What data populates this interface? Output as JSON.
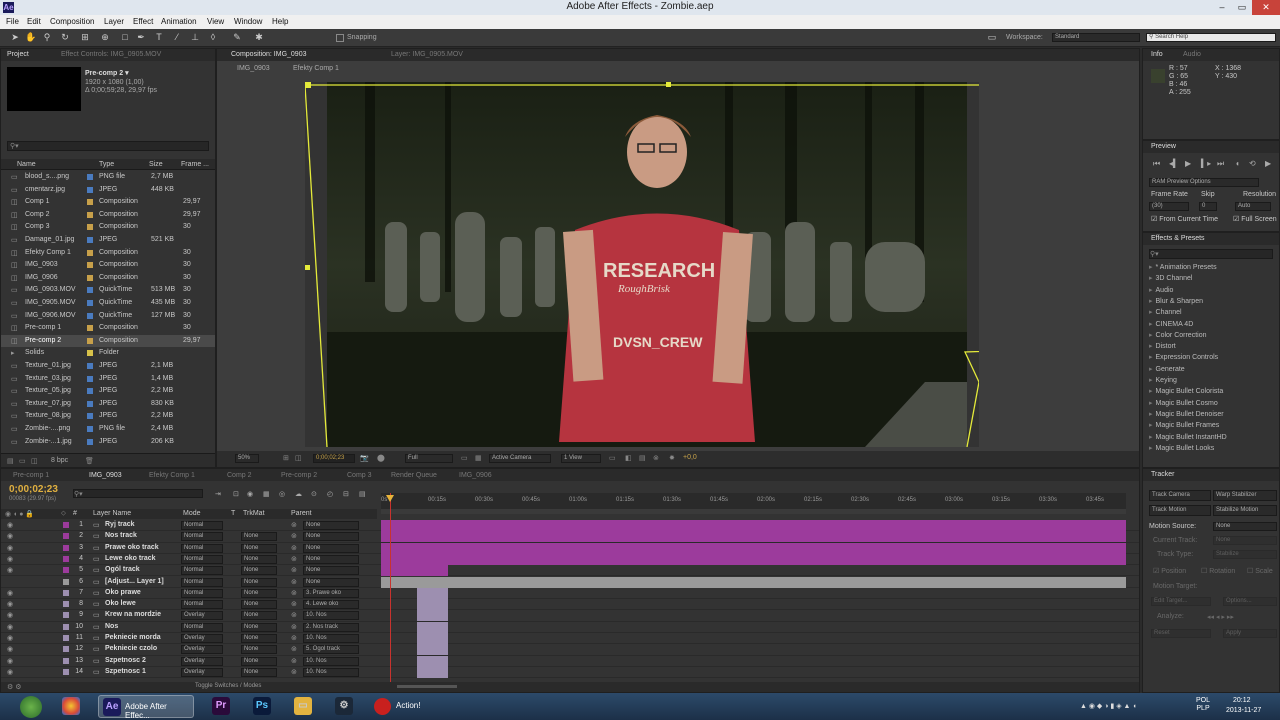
{
  "window": {
    "title": "Adobe After Effects - Zombie.aep",
    "app_icon": "Ae"
  },
  "menu": [
    "File",
    "Edit",
    "Composition",
    "Layer",
    "Effect",
    "Animation",
    "View",
    "Window",
    "Help"
  ],
  "toolbar": {
    "snapping": "Snapping",
    "workspace_label": "Workspace:",
    "workspace_value": "Standard",
    "search_placeholder": "Search Help"
  },
  "project": {
    "tabs": [
      "Project",
      "Effect Controls: IMG_0905.MOV"
    ],
    "selected": {
      "name": "Pre-comp 2 ▾",
      "size": "1920 x 1080 (1,00)",
      "duration": "Δ 0;00;59;28, 29,97 fps"
    },
    "columns": [
      "Name",
      "Type",
      "Size",
      "Frame ..."
    ],
    "items": [
      {
        "name": "blood_s....png",
        "type": "PNG file",
        "size": "2,7 MB",
        "frame": "",
        "color": "#4a7bbf"
      },
      {
        "name": "cmentarz.jpg",
        "type": "JPEG",
        "size": "448 KB",
        "frame": "",
        "color": "#4a7bbf"
      },
      {
        "name": "Comp 1",
        "type": "Composition",
        "size": "",
        "frame": "29,97",
        "color": "#c7a04a"
      },
      {
        "name": "Comp 2",
        "type": "Composition",
        "size": "",
        "frame": "29,97",
        "color": "#c7a04a"
      },
      {
        "name": "Comp 3",
        "type": "Composition",
        "size": "",
        "frame": "30",
        "color": "#c7a04a"
      },
      {
        "name": "Damage_01.jpg",
        "type": "JPEG",
        "size": "521 KB",
        "frame": "",
        "color": "#4a7bbf"
      },
      {
        "name": "Efekty Comp 1",
        "type": "Composition",
        "size": "",
        "frame": "30",
        "color": "#c7a04a"
      },
      {
        "name": "IMG_0903",
        "type": "Composition",
        "size": "",
        "frame": "30",
        "color": "#c7a04a"
      },
      {
        "name": "IMG_0906",
        "type": "Composition",
        "size": "",
        "frame": "30",
        "color": "#c7a04a"
      },
      {
        "name": "IMG_0903.MOV",
        "type": "QuickTime",
        "size": "513 MB",
        "frame": "30",
        "color": "#4a7bbf"
      },
      {
        "name": "IMG_0905.MOV",
        "type": "QuickTime",
        "size": "435 MB",
        "frame": "30",
        "color": "#4a7bbf"
      },
      {
        "name": "IMG_0906.MOV",
        "type": "QuickTime",
        "size": "127 MB",
        "frame": "30",
        "color": "#4a7bbf"
      },
      {
        "name": "Pre-comp 1",
        "type": "Composition",
        "size": "",
        "frame": "30",
        "color": "#c7a04a"
      },
      {
        "name": "Pre-comp 2",
        "type": "Composition",
        "size": "",
        "frame": "29,97",
        "color": "#c7a04a"
      },
      {
        "name": "Solids",
        "type": "Folder",
        "size": "",
        "frame": "",
        "color": "#d8c24a"
      },
      {
        "name": "Texture_01.jpg",
        "type": "JPEG",
        "size": "2,1 MB",
        "frame": "",
        "color": "#4a7bbf"
      },
      {
        "name": "Texture_03.jpg",
        "type": "JPEG",
        "size": "1,4 MB",
        "frame": "",
        "color": "#4a7bbf"
      },
      {
        "name": "Texture_05.jpg",
        "type": "JPEG",
        "size": "2,2 MB",
        "frame": "",
        "color": "#4a7bbf"
      },
      {
        "name": "Texture_07.jpg",
        "type": "JPEG",
        "size": "830 KB",
        "frame": "",
        "color": "#4a7bbf"
      },
      {
        "name": "Texture_08.jpg",
        "type": "JPEG",
        "size": "2,2 MB",
        "frame": "",
        "color": "#4a7bbf"
      },
      {
        "name": "Zombie-....png",
        "type": "PNG file",
        "size": "2,4 MB",
        "frame": "",
        "color": "#4a7bbf"
      },
      {
        "name": "Zombie-...1.jpg",
        "type": "JPEG",
        "size": "206 KB",
        "frame": "",
        "color": "#4a7bbf"
      }
    ],
    "bpc": "8 bpc"
  },
  "composition": {
    "tabs": [
      "Composition: IMG_0903",
      "Layer: IMG_0905.MOV"
    ],
    "breadcrumbs": [
      "IMG_0903",
      "Efekty Comp 1"
    ],
    "zoom": "50%",
    "timecode": "0;00;02;23",
    "resolution": "Full",
    "camera": "Active Camera",
    "view": "1 View",
    "exposure": "+0,0",
    "shirt_text": [
      "RESEARCH",
      "RoughBrisk",
      "DVSN_CREW"
    ]
  },
  "info": {
    "tabs": [
      "Info",
      "Audio"
    ],
    "r": "R : 57",
    "g": "G : 65",
    "b": "B : 46",
    "a": "A : 255",
    "x": "X : 1368",
    "y": "Y : 430"
  },
  "preview": {
    "tab": "Preview",
    "ram_options": "RAM Preview Options",
    "frame_rate_label": "Frame Rate",
    "skip_label": "Skip",
    "resolution_label": "Resolution",
    "frame_rate": "(30)",
    "skip": "0",
    "resolution": "Auto",
    "from_current": "From Current Time",
    "full_screen": "Full Screen"
  },
  "effects": {
    "tab": "Effects & Presets",
    "items": [
      "* Animation Presets",
      "3D Channel",
      "Audio",
      "Blur & Sharpen",
      "Channel",
      "CINEMA 4D",
      "Color Correction",
      "Distort",
      "Expression Controls",
      "Generate",
      "Keying",
      "Magic Bullet Colorista",
      "Magic Bullet Cosmo",
      "Magic Bullet Denoiser",
      "Magic Bullet Frames",
      "Magic Bullet InstantHD",
      "Magic Bullet Looks"
    ]
  },
  "tracker": {
    "tab": "Tracker",
    "track_camera": "Track Camera",
    "warp_stabilizer": "Warp Stabilizer",
    "track_motion": "Track Motion",
    "stabilize_motion": "Stabilize Motion",
    "motion_source_label": "Motion Source:",
    "motion_source": "None",
    "current_track": "Current Track:",
    "current_track_value": "None",
    "track_type": "Track Type:",
    "track_type_value": "Stabilize",
    "position": "Position",
    "rotation": "Rotation",
    "scale": "Scale",
    "motion_target": "Motion Target:",
    "edit_target": "Edit Target...",
    "options": "Options...",
    "analyze": "Analyze:",
    "reset": "Reset",
    "apply": "Apply"
  },
  "timeline": {
    "tabs": [
      "Pre-comp 1",
      "IMG_0903",
      "Efekty Comp 1",
      "Comp 2",
      "Pre-comp 2",
      "Comp 3",
      "Render Queue",
      "IMG_0906"
    ],
    "timecode": "0;00;02;23",
    "frames": "00083 (29.97 fps)",
    "columns": [
      "#",
      "Layer Name",
      "Mode",
      "T",
      "TrkMat",
      "Parent"
    ],
    "ruler": [
      "0s",
      "00:15s",
      "00:30s",
      "00:45s",
      "01:00s",
      "01:15s",
      "01:30s",
      "01:45s",
      "02:00s",
      "02:15s",
      "02:30s",
      "02:45s",
      "03:00s",
      "03:15s",
      "03:30s",
      "03:45s"
    ],
    "layers": [
      {
        "num": "1",
        "name": "Ryj track",
        "mode": "Normal",
        "trkmat": "",
        "parent": "None",
        "bar_start": 0.0,
        "bar_end": 1.0,
        "bar_color": "#9c3b9c"
      },
      {
        "num": "2",
        "name": "Nos track",
        "mode": "Normal",
        "trkmat": "None",
        "parent": "None",
        "bar_start": 0.0,
        "bar_end": 1.0,
        "bar_color": "#9c3b9c"
      },
      {
        "num": "3",
        "name": "Prawe oko track",
        "mode": "Normal",
        "trkmat": "None",
        "parent": "None",
        "bar_start": 0.0,
        "bar_end": 1.0,
        "bar_color": "#9c3b9c"
      },
      {
        "num": "4",
        "name": "Lewe oko track",
        "mode": "Normal",
        "trkmat": "None",
        "parent": "None",
        "bar_start": 0.0,
        "bar_end": 1.0,
        "bar_color": "#9c3b9c"
      },
      {
        "num": "5",
        "name": "Ogól track",
        "mode": "Normal",
        "trkmat": "None",
        "parent": "None",
        "bar_start": 0.0,
        "bar_end": 0.09,
        "bar_color": "#9c3b9c"
      },
      {
        "num": "6",
        "name": "[Adjust... Layer 1]",
        "mode": "Normal",
        "trkmat": "None",
        "parent": "None",
        "bar_start": 0.0,
        "bar_end": 1.0,
        "bar_color": "#9a9a9a"
      },
      {
        "num": "7",
        "name": "Oko prawe",
        "mode": "Normal",
        "trkmat": "None",
        "parent": "3. Prawe oko",
        "bar_start": 0.048,
        "bar_end": 0.09,
        "bar_color": "#9d8fb0"
      },
      {
        "num": "8",
        "name": "Oko lewe",
        "mode": "Normal",
        "trkmat": "None",
        "parent": "4. Lewe oko",
        "bar_start": 0.048,
        "bar_end": 0.09,
        "bar_color": "#9d8fb0"
      },
      {
        "num": "9",
        "name": "Krew na mordzie",
        "mode": "Overlay",
        "trkmat": "None",
        "parent": "10. Nos",
        "bar_start": 0.048,
        "bar_end": 0.09,
        "bar_color": "#9d8fb0"
      },
      {
        "num": "10",
        "name": "Nos",
        "mode": "Normal",
        "trkmat": "None",
        "parent": "2. Nos track",
        "bar_start": 0.048,
        "bar_end": 0.09,
        "bar_color": "#9d8fb0"
      },
      {
        "num": "11",
        "name": "Pekniecie morda",
        "mode": "Overlay",
        "trkmat": "None",
        "parent": "10. Nos",
        "bar_start": 0.048,
        "bar_end": 0.09,
        "bar_color": "#9d8fb0"
      },
      {
        "num": "12",
        "name": "Pekniecie czolo",
        "mode": "Overlay",
        "trkmat": "None",
        "parent": "5. Ogol track",
        "bar_start": 0.048,
        "bar_end": 0.09,
        "bar_color": "#9d8fb0"
      },
      {
        "num": "13",
        "name": "Szpetnosc 2",
        "mode": "Overlay",
        "trkmat": "None",
        "parent": "10. Nos",
        "bar_start": 0.048,
        "bar_end": 0.09,
        "bar_color": "#9d8fb0"
      },
      {
        "num": "14",
        "name": "Szpetnosc 1",
        "mode": "Overlay",
        "trkmat": "None",
        "parent": "10. Nos",
        "bar_start": 0.048,
        "bar_end": 0.09,
        "bar_color": "#9d8fb0"
      }
    ],
    "toggle_label": "Toggle Switches / Modes"
  },
  "taskbar": {
    "apps": [
      "Adobe After Effec...",
      "Action!"
    ],
    "lang": "POL\nPLP",
    "time": "20:12",
    "date": "2013-11-27"
  }
}
